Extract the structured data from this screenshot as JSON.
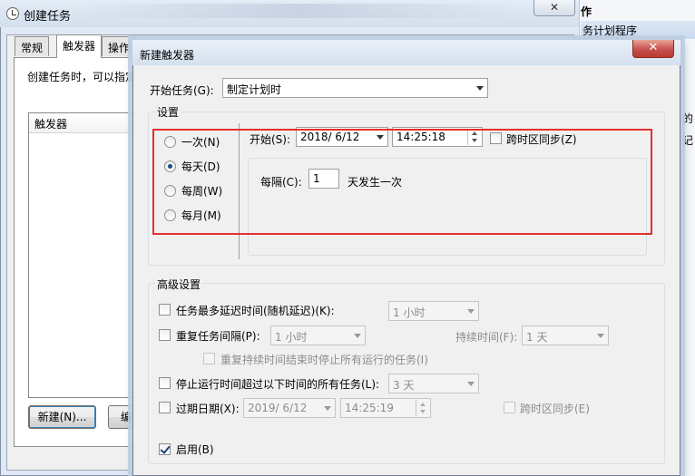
{
  "background_window": {
    "title": "创建任务",
    "close_glyph": "✕",
    "tabs": [
      "常规",
      "触发器",
      "操作"
    ],
    "description": "创建任务时，可以指定",
    "list_header": "触发器",
    "new_button": "新建(N)...",
    "edit_button": "编"
  },
  "right_panel": {
    "title": "作",
    "item": "务计划程序",
    "sub1": "的",
    "sub2": "记"
  },
  "dialog": {
    "title": "新建触发器",
    "close_glyph": "✕",
    "begin_task_label": "开始任务(G):",
    "begin_task_value": "制定计划时",
    "settings_group": "设置",
    "schedule_options": [
      {
        "label": "一次(N)",
        "checked": false
      },
      {
        "label": "每天(D)",
        "checked": true
      },
      {
        "label": "每周(W)",
        "checked": false
      },
      {
        "label": "每月(M)",
        "checked": false
      }
    ],
    "start_label": "开始(S):",
    "start_date": "2018/  6/12",
    "start_time": "14:25:18",
    "sync_timezones_label": "跨时区同步(Z)",
    "recur_every_label": "每隔(C):",
    "recur_value": "1",
    "recur_suffix": "天发生一次",
    "advanced_group": "高级设置",
    "delay_label": "任务最多延迟时间(随机延迟)(K):",
    "delay_value": "1 小时",
    "repeat_label": "重复任务间隔(P):",
    "repeat_value": "1 小时",
    "duration_label": "持续时间(F):",
    "duration_value": "1 天",
    "stop_all_label": "重复持续时间结束时停止所有运行的任务(I)",
    "stop_if_longer_label": "停止运行时间超过以下时间的所有任务(L):",
    "stop_if_longer_value": "3 天",
    "expire_label": "过期日期(X):",
    "expire_date": "2019/  6/12",
    "expire_time": "14:25:19",
    "expire_sync_label": "跨时区同步(E)",
    "enabled_label": "启用(B)"
  },
  "colors": {
    "highlight_box": "#e3302f",
    "close_button": "#c75050"
  }
}
